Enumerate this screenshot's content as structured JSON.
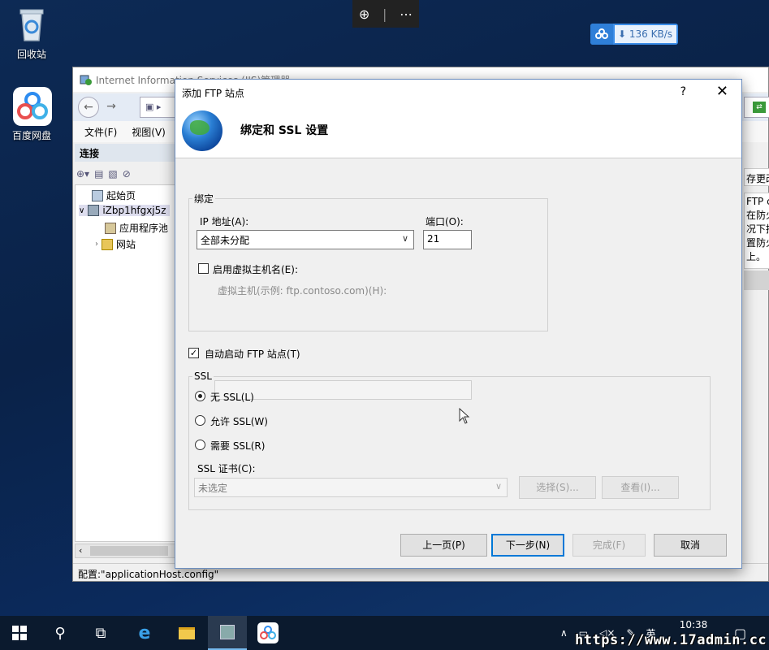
{
  "desktop": {
    "recycle_bin": "回收站",
    "baidu_netdisk": "百度网盘",
    "speed": "136 KB/s"
  },
  "iis": {
    "title": "Internet Information Services (IIS)管理器",
    "menu": [
      "文件(F)",
      "视图(V)"
    ],
    "connections_header": "连接",
    "tree": {
      "start_page": "起始页",
      "server": "iZbp1hfgxj5z",
      "app_pools": "应用程序池",
      "sites": "网站"
    },
    "status": "配置:\"applicationHost.config\"",
    "right_panel": {
      "save_changes": "存更改",
      "lines": [
        "FTP c",
        "在防火",
        "况下摂",
        "置防火",
        "上。"
      ]
    }
  },
  "dialog": {
    "title": "添加 FTP 站点",
    "help": "?",
    "heading": "绑定和 SSL 设置",
    "binding": {
      "legend": "绑定",
      "ip_label": "IP 地址(A):",
      "ip_value": "全部未分配",
      "port_label": "端口(O):",
      "port_value": "21",
      "virtual_host_check": "启用虚拟主机名(E):",
      "virtual_host_label": "虚拟主机(示例: ftp.contoso.com)(H):",
      "virtual_host_value": ""
    },
    "auto_start": "自动启动 FTP 站点(T)",
    "ssl": {
      "legend": "SSL",
      "no_ssl": "无 SSL(L)",
      "allow_ssl": "允许 SSL(W)",
      "require_ssl": "需要 SSL(R)",
      "cert_label": "SSL 证书(C):",
      "cert_value": "未选定",
      "select_btn": "选择(S)...",
      "view_btn": "查看(I)..."
    },
    "buttons": {
      "prev": "上一页(P)",
      "next": "下一步(N)",
      "finish": "完成(F)",
      "cancel": "取消"
    }
  },
  "taskbar": {
    "ime": "英",
    "time": "10:38"
  },
  "watermark": "https://www.17admin.cc"
}
